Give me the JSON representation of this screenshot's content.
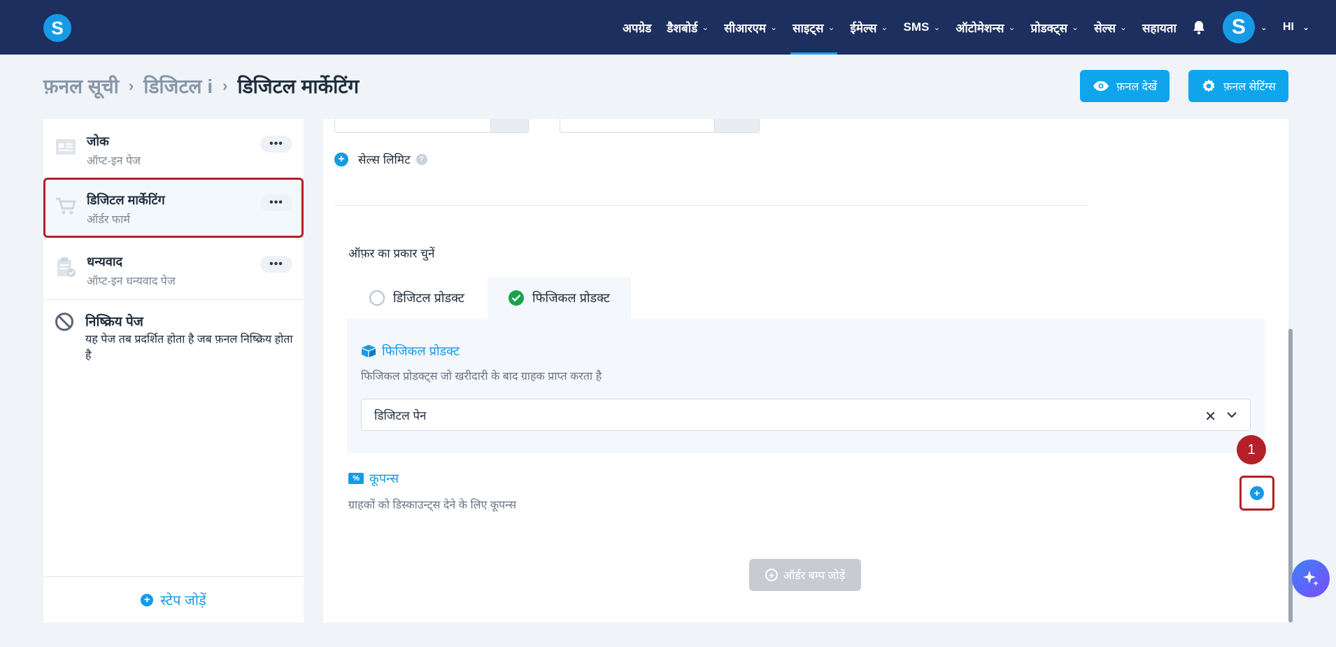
{
  "nav": {
    "logo": "S",
    "items": [
      {
        "label": "अपग्रेड",
        "chevron": false,
        "active": false
      },
      {
        "label": "डैशबोर्ड",
        "chevron": true,
        "active": false
      },
      {
        "label": "सीआरएम",
        "chevron": true,
        "active": false
      },
      {
        "label": "साइट्स",
        "chevron": true,
        "active": true
      },
      {
        "label": "ईमेल्स",
        "chevron": true,
        "active": false
      },
      {
        "label": "SMS",
        "chevron": true,
        "active": false
      },
      {
        "label": "ऑटोमेशन्स",
        "chevron": true,
        "active": false
      },
      {
        "label": "प्रोडक्ट्स",
        "chevron": true,
        "active": false
      },
      {
        "label": "सेल्स",
        "chevron": true,
        "active": false
      },
      {
        "label": "सहायता",
        "chevron": false,
        "active": false
      }
    ],
    "avatar": "S",
    "language": "HI"
  },
  "breadcrumb": {
    "root": "फ़नल सूची",
    "middle": "डिजिटल i",
    "current": "डिजिटल मार्केटिंग"
  },
  "header_buttons": {
    "view_funnel": "फ़नल देखें",
    "funnel_settings": "फ़नल सेटिंग्स"
  },
  "sidebar": {
    "steps": [
      {
        "title": "जोक",
        "subtitle": "ऑप्ट-इन पेज",
        "menu": "•••"
      },
      {
        "title": "डिजिटल मार्केटिंग",
        "subtitle": "ऑर्डर फार्म",
        "menu": "•••"
      },
      {
        "title": "धन्यवाद",
        "subtitle": "ऑप्ट-इन धन्यवाद पेज",
        "menu": "•••"
      }
    ],
    "inactive_title": "निष्क्रिय पेज",
    "inactive_desc": "यह पेज तब प्रदर्शित होता है जब फ़नल निष्क्रिय होता है",
    "add_step": "स्टेप जोड़ें"
  },
  "main": {
    "sales_limit": "सेल्स लिमिट",
    "help": "?",
    "offer_type_label": "ऑफ़र का प्रकार चुनें",
    "tabs": {
      "digital": "डिजिटल प्रोडक्ट",
      "physical": "फिजिकल प्रोडक्ट"
    },
    "physical_section": {
      "title": "फिजिकल प्रोडक्ट",
      "desc": "फिजिकल प्रोडक्ट्स जो खरीदारी के बाद ग्राहक प्राप्त करता है",
      "selected_value": "डिजिटल पेन",
      "clear": "✕"
    },
    "coupons": {
      "title": "कूपन्स",
      "desc": "ग्राहकों को डिस्काउन्ट्स देने के लिए कूपन्स"
    },
    "annotation_badge": "1",
    "order_bump": "ऑर्डर बम्प जोड़ें"
  },
  "colors": {
    "nav_bg": "#1c2f5e",
    "accent": "#169ae6",
    "highlight_red": "#b42028",
    "success": "#1aa34a"
  }
}
